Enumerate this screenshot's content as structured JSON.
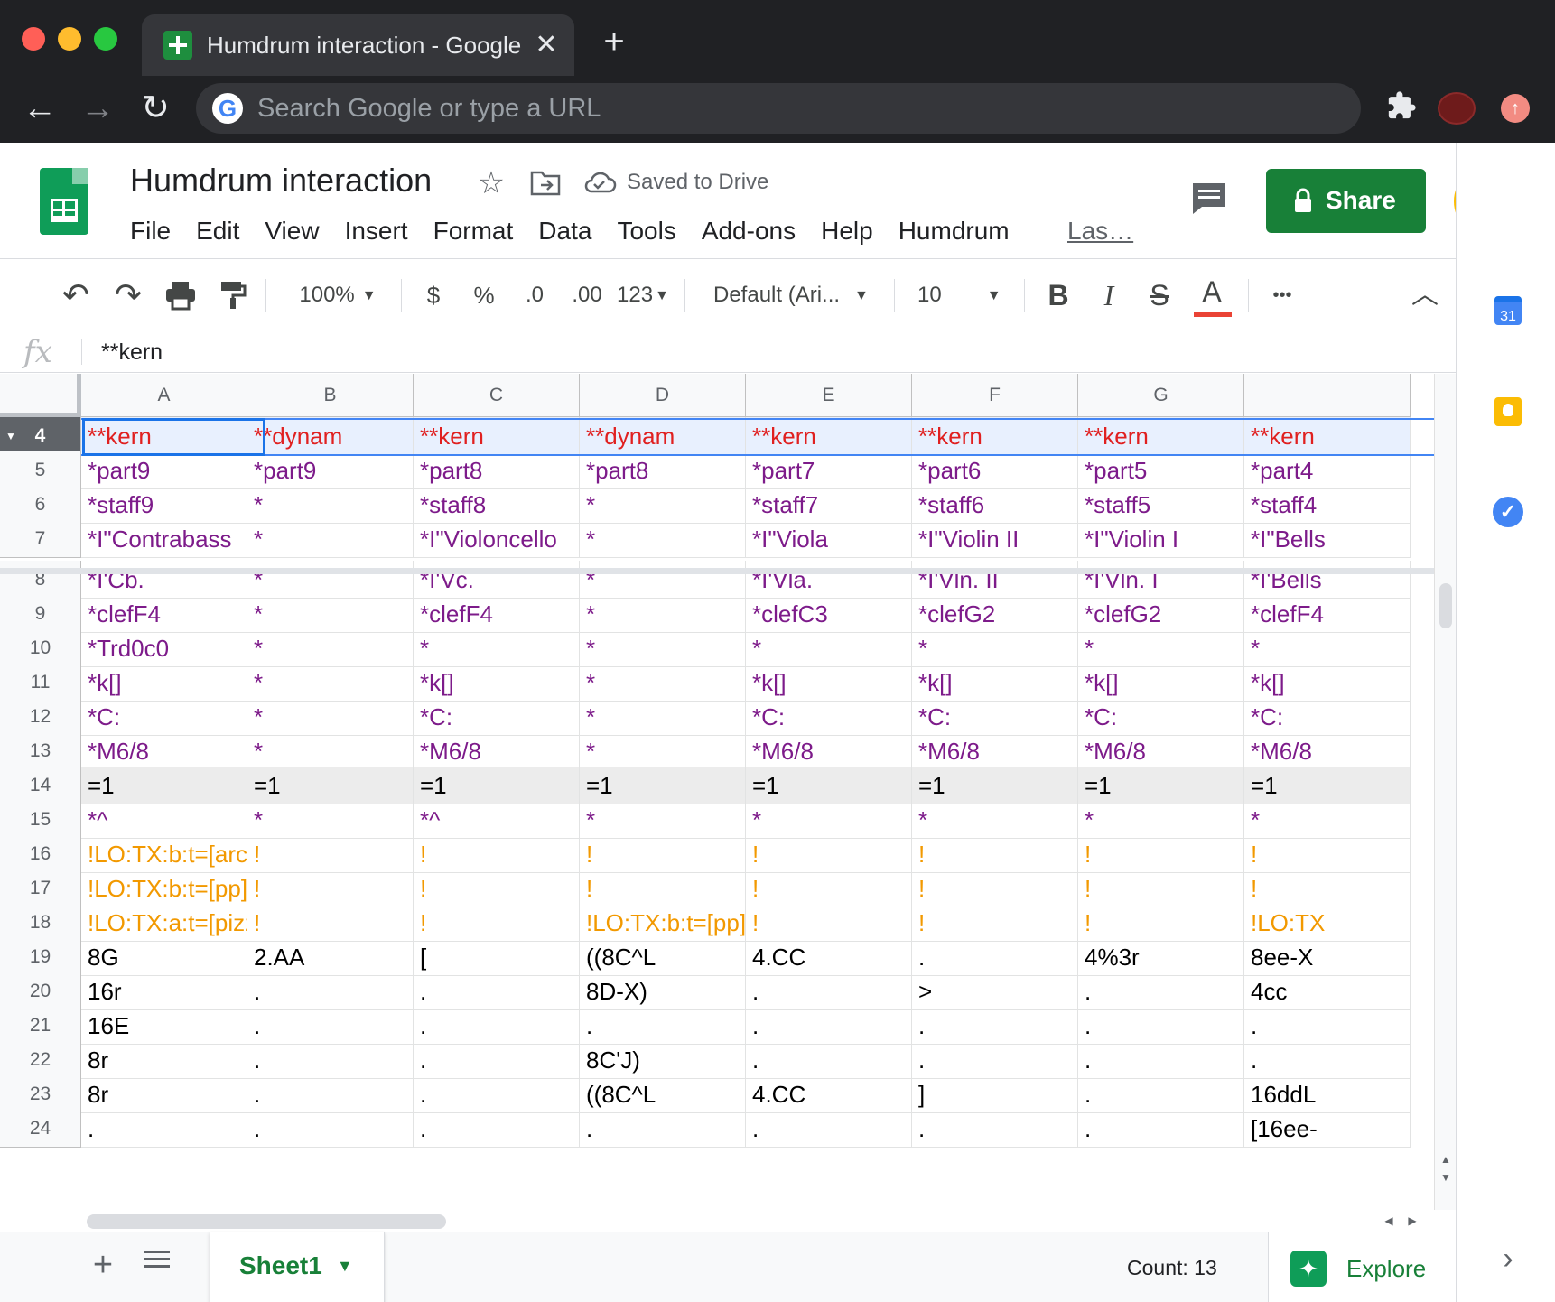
{
  "browser": {
    "tab_title": "Humdrum interaction - Google Sheets",
    "tab_close": "✕",
    "new_tab": "+",
    "back": "←",
    "forward": "→",
    "reload": "↻",
    "omnibox_placeholder": "Search Google or type a URL",
    "google_mark": "G",
    "extensions_icon": "puzzle-piece-icon",
    "update_icon": "↑"
  },
  "sheets": {
    "doc_title": "Humdrum interaction",
    "star": "☆",
    "saved_status": "Saved to Drive",
    "menu": [
      "File",
      "Edit",
      "View",
      "Insert",
      "Format",
      "Data",
      "Tools",
      "Add-ons",
      "Help",
      "Humdrum"
    ],
    "last_edit": "Las…",
    "share_label": "Share",
    "brand_green": "#0f9d58",
    "share_green": "#188038"
  },
  "toolbar": {
    "undo": "↶",
    "redo": "↷",
    "zoom": "100%",
    "currency": "$",
    "percent": "%",
    "dec_decrease": ".0",
    "dec_increase": ".00",
    "more_formats": "123",
    "font": "Default (Ari...",
    "font_size": "10",
    "bold": "B",
    "italic": "I",
    "strike": "S",
    "text_color": "A",
    "more": "•••",
    "collapse": "︿",
    "text_color_swatch": "#ea4335"
  },
  "formula_bar": {
    "fx": "fx",
    "value": "**kern"
  },
  "grid": {
    "columns": [
      "A",
      "B",
      "C",
      "D",
      "E",
      "F",
      "G",
      ""
    ],
    "rows": [
      {
        "n": "4",
        "style": "header",
        "cells": [
          [
            "**kern",
            "red"
          ],
          [
            "**dynam",
            "red"
          ],
          [
            "**kern",
            "red"
          ],
          [
            "**dynam",
            "red"
          ],
          [
            "**kern",
            "red"
          ],
          [
            "**kern",
            "red"
          ],
          [
            "**kern",
            "red"
          ],
          [
            "**kern",
            "red"
          ]
        ]
      },
      {
        "n": "5",
        "cells": [
          [
            "*part9",
            "purple"
          ],
          [
            "*part9",
            "purple"
          ],
          [
            "*part8",
            "purple"
          ],
          [
            "*part8",
            "purple"
          ],
          [
            "*part7",
            "purple"
          ],
          [
            "*part6",
            "purple"
          ],
          [
            "*part5",
            "purple"
          ],
          [
            "*part4",
            "purple"
          ]
        ]
      },
      {
        "n": "6",
        "cells": [
          [
            "*staff9",
            "purple"
          ],
          [
            "*",
            "purple"
          ],
          [
            "*staff8",
            "purple"
          ],
          [
            "*",
            "purple"
          ],
          [
            "*staff7",
            "purple"
          ],
          [
            "*staff6",
            "purple"
          ],
          [
            "*staff5",
            "purple"
          ],
          [
            "*staff4",
            "purple"
          ]
        ]
      },
      {
        "n": "7",
        "cells": [
          [
            "*I\"Contrabass",
            "purple"
          ],
          [
            "*",
            "purple"
          ],
          [
            "*I\"Violoncello",
            "purple"
          ],
          [
            "*",
            "purple"
          ],
          [
            "*I\"Viola",
            "purple"
          ],
          [
            "*I\"Violin II",
            "purple"
          ],
          [
            "*I\"Violin I",
            "purple"
          ],
          [
            "*I\"Bells",
            "purple"
          ]
        ]
      },
      {
        "n": "8",
        "cells": [
          [
            "*I'Cb.",
            "purple"
          ],
          [
            "*",
            "purple"
          ],
          [
            "*I'Vc.",
            "purple"
          ],
          [
            "*",
            "purple"
          ],
          [
            "*I'Vla.",
            "purple"
          ],
          [
            "*I'Vln. II",
            "purple"
          ],
          [
            "*I'Vln. I",
            "purple"
          ],
          [
            "*I'Bells",
            "purple"
          ]
        ]
      },
      {
        "n": "9",
        "cells": [
          [
            "*clefF4",
            "purple"
          ],
          [
            "*",
            "purple"
          ],
          [
            "*clefF4",
            "purple"
          ],
          [
            "*",
            "purple"
          ],
          [
            "*clefC3",
            "purple"
          ],
          [
            "*clefG2",
            "purple"
          ],
          [
            "*clefG2",
            "purple"
          ],
          [
            "*clefF4",
            "purple"
          ]
        ]
      },
      {
        "n": "10",
        "cells": [
          [
            "*Trd0c0",
            "purple"
          ],
          [
            "*",
            "purple"
          ],
          [
            "*",
            "purple"
          ],
          [
            "*",
            "purple"
          ],
          [
            "*",
            "purple"
          ],
          [
            "*",
            "purple"
          ],
          [
            "*",
            "purple"
          ],
          [
            "*",
            "purple"
          ]
        ]
      },
      {
        "n": "11",
        "cells": [
          [
            "*k[]",
            "purple"
          ],
          [
            "*",
            "purple"
          ],
          [
            "*k[]",
            "purple"
          ],
          [
            "*",
            "purple"
          ],
          [
            "*k[]",
            "purple"
          ],
          [
            "*k[]",
            "purple"
          ],
          [
            "*k[]",
            "purple"
          ],
          [
            "*k[]",
            "purple"
          ]
        ]
      },
      {
        "n": "12",
        "cells": [
          [
            "*C:",
            "purple"
          ],
          [
            "*",
            "purple"
          ],
          [
            "*C:",
            "purple"
          ],
          [
            "*",
            "purple"
          ],
          [
            "*C:",
            "purple"
          ],
          [
            "*C:",
            "purple"
          ],
          [
            "*C:",
            "purple"
          ],
          [
            "*C:",
            "purple"
          ]
        ]
      },
      {
        "n": "13",
        "cells": [
          [
            "*M6/8",
            "purple"
          ],
          [
            "*",
            "purple"
          ],
          [
            "*M6/8",
            "purple"
          ],
          [
            "*",
            "purple"
          ],
          [
            "*M6/8",
            "purple"
          ],
          [
            "*M6/8",
            "purple"
          ],
          [
            "*M6/8",
            "purple"
          ],
          [
            "*M6/8",
            "purple"
          ]
        ]
      },
      {
        "n": "14",
        "style": "barline",
        "cells": [
          [
            "=1",
            "black"
          ],
          [
            "=1",
            "black"
          ],
          [
            "=1",
            "black"
          ],
          [
            "=1",
            "black"
          ],
          [
            "=1",
            "black"
          ],
          [
            "=1",
            "black"
          ],
          [
            "=1",
            "black"
          ],
          [
            "=1",
            "black"
          ]
        ]
      },
      {
        "n": "15",
        "cells": [
          [
            "*^",
            "purple"
          ],
          [
            "*",
            "purple"
          ],
          [
            "*^",
            "purple"
          ],
          [
            "*",
            "purple"
          ],
          [
            "*",
            "purple"
          ],
          [
            "*",
            "purple"
          ],
          [
            "*",
            "purple"
          ],
          [
            "*",
            "purple"
          ]
        ]
      },
      {
        "n": "16",
        "cells": [
          [
            "!LO:TX:b:t=[arco]",
            "orange"
          ],
          [
            "!",
            "orange"
          ],
          [
            "!",
            "orange"
          ],
          [
            "!",
            "orange"
          ],
          [
            "!",
            "orange"
          ],
          [
            "!",
            "orange"
          ],
          [
            "!",
            "orange"
          ],
          [
            "!",
            "orange"
          ]
        ]
      },
      {
        "n": "17",
        "cells": [
          [
            "!LO:TX:b:t=[pp]",
            "orange"
          ],
          [
            "!",
            "orange"
          ],
          [
            "!",
            "orange"
          ],
          [
            "!",
            "orange"
          ],
          [
            "!",
            "orange"
          ],
          [
            "!",
            "orange"
          ],
          [
            "!",
            "orange"
          ],
          [
            "!",
            "orange"
          ]
        ]
      },
      {
        "n": "18",
        "cells": [
          [
            "!LO:TX:a:t=[pizz]",
            "orange"
          ],
          [
            "!",
            "orange"
          ],
          [
            "!",
            "orange"
          ],
          [
            "!LO:TX:b:t=[pp]",
            "orange"
          ],
          [
            "!",
            "orange"
          ],
          [
            "!",
            "orange"
          ],
          [
            "!",
            "orange"
          ],
          [
            "!LO:TX",
            "orange"
          ]
        ]
      },
      {
        "n": "19",
        "cells": [
          [
            "8G",
            "black"
          ],
          [
            "2.AA",
            "black"
          ],
          [
            "[",
            "black"
          ],
          [
            "((8C^L",
            "black"
          ],
          [
            "4.CC",
            "black"
          ],
          [
            ".",
            "black"
          ],
          [
            "4%3r",
            "black"
          ],
          [
            "8ee-X",
            "black"
          ]
        ]
      },
      {
        "n": "20",
        "cells": [
          [
            "16r",
            "black"
          ],
          [
            ".",
            "black"
          ],
          [
            ".",
            "black"
          ],
          [
            "8D-X)",
            "black"
          ],
          [
            ".",
            "black"
          ],
          [
            ">",
            "black"
          ],
          [
            ".",
            "black"
          ],
          [
            "4cc",
            "black"
          ]
        ]
      },
      {
        "n": "21",
        "cells": [
          [
            "16E",
            "black"
          ],
          [
            ".",
            "black"
          ],
          [
            ".",
            "black"
          ],
          [
            ".",
            "black"
          ],
          [
            ".",
            "black"
          ],
          [
            ".",
            "black"
          ],
          [
            ".",
            "black"
          ],
          [
            ".",
            "black"
          ]
        ]
      },
      {
        "n": "22",
        "cells": [
          [
            "8r",
            "black"
          ],
          [
            ".",
            "black"
          ],
          [
            ".",
            "black"
          ],
          [
            "8C'J)",
            "black"
          ],
          [
            ".",
            "black"
          ],
          [
            ".",
            "black"
          ],
          [
            ".",
            "black"
          ],
          [
            ".",
            "black"
          ]
        ]
      },
      {
        "n": "23",
        "cells": [
          [
            "8r",
            "black"
          ],
          [
            ".",
            "black"
          ],
          [
            ".",
            "black"
          ],
          [
            "((8C^L",
            "black"
          ],
          [
            "4.CC",
            "black"
          ],
          [
            "]",
            "black"
          ],
          [
            ".",
            "black"
          ],
          [
            "16ddL",
            "black"
          ]
        ]
      },
      {
        "n": "24",
        "cells": [
          [
            ".",
            "black"
          ],
          [
            ".",
            "black"
          ],
          [
            ".",
            "black"
          ],
          [
            ".",
            "black"
          ],
          [
            ".",
            "black"
          ],
          [
            ".",
            "black"
          ],
          [
            ".",
            "black"
          ],
          [
            "[16ee-",
            "black"
          ]
        ]
      }
    ],
    "colors": {
      "red": "#e02020",
      "purple": "#7d1b8a",
      "orange": "#f29900",
      "black": "#000000"
    }
  },
  "bottom": {
    "add_sheet": "+",
    "sheet_name": "Sheet1",
    "sheet_caret": "▼",
    "count": "Count: 13",
    "explore_label": "Explore",
    "explore_icon": "✦"
  },
  "side_panel": {
    "calendar_day": "31",
    "tasks_mark": "✓",
    "expand": "›"
  }
}
